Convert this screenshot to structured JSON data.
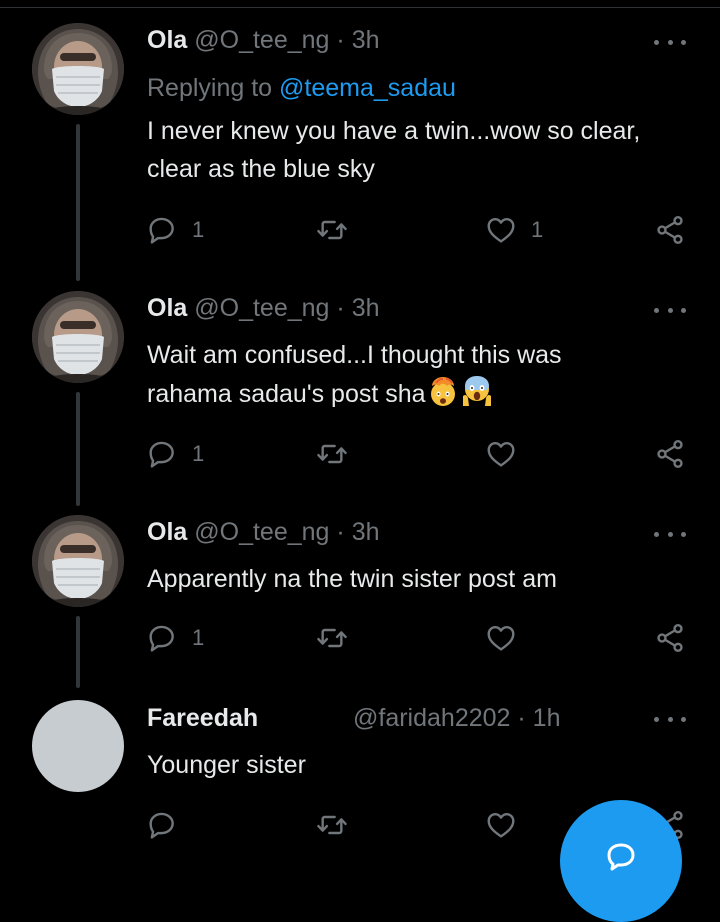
{
  "tweets": [
    {
      "name": "Ola",
      "handle": "@O_tee_ng",
      "dot": "·",
      "time": "3h",
      "replying_prefix": "Replying to",
      "replying_handle": "@teema_sadau",
      "text": "I never knew you have a twin...wow so clear, clear as the blue sky",
      "reply_count": "1",
      "like_count": "1"
    },
    {
      "name": "Ola",
      "handle": "@O_tee_ng",
      "dot": "·",
      "time": "3h",
      "text": "Wait am confused...I thought this was rahama sadau's post sha",
      "emojis": [
        "exploding-head-emoji",
        "screaming-face-emoji"
      ],
      "reply_count": "1"
    },
    {
      "name": "Ola",
      "handle": "@O_tee_ng",
      "dot": "·",
      "time": "3h",
      "text": "Apparently na the twin sister post am",
      "reply_count": "1"
    },
    {
      "name": "Fareedah",
      "handle": "@faridah2202",
      "dot": "·",
      "time": "1h",
      "text": "Younger sister"
    }
  ],
  "icons": {
    "reply": "reply-icon",
    "retweet": "retweet-icon",
    "like": "heart-icon",
    "share": "share-icon",
    "more": "more-icon",
    "compose": "compose-icon"
  },
  "colors": {
    "background": "#000000",
    "text": "#e7e9ea",
    "secondary": "#71767b",
    "accent": "#1d9bf0"
  }
}
